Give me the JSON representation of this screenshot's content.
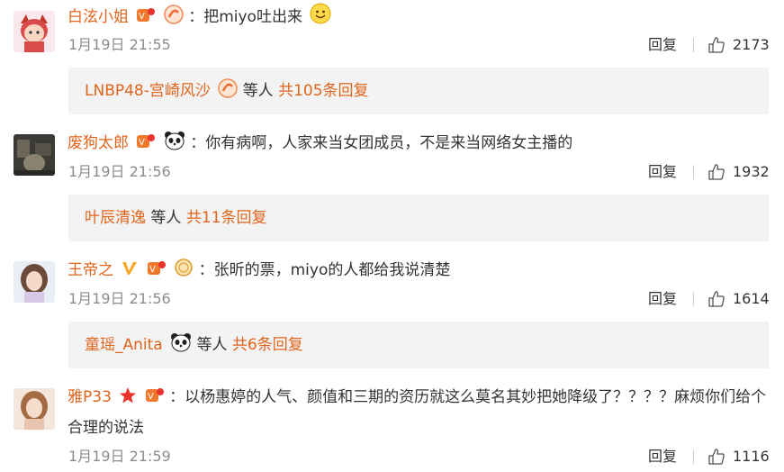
{
  "comments": [
    {
      "username": "白泫小姐",
      "text": "：把miyo吐出来",
      "timestamp": "1月19日 21:55",
      "reply_label": "回复",
      "likes": "2173",
      "reply_summary": {
        "names": "LNBP48-宫崎风沙",
        "mid": "等人",
        "count_text": "共105条回复"
      }
    },
    {
      "username": "废狗太郎",
      "text": "：你有病啊，人家来当女团成员，不是来当网络女主播的",
      "timestamp": "1月19日 21:56",
      "reply_label": "回复",
      "likes": "1932",
      "reply_summary": {
        "names": "叶辰清逸",
        "mid": "等人",
        "count_text": "共11条回复"
      }
    },
    {
      "username": "王帝之",
      "text": "：张昕的票，miyo的人都给我说清楚",
      "timestamp": "1月19日 21:56",
      "reply_label": "回复",
      "likes": "1614",
      "reply_summary": {
        "names": "童瑶_Anita",
        "mid": "等人",
        "count_text": "共6条回复"
      }
    },
    {
      "username": "雅P33",
      "text": "：以杨惠婷的人气、颜值和三期的资历就这么莫名其妙把她降级了？？？？麻烦你们给个合理的说法",
      "timestamp": "1月19日 21:59",
      "reply_label": "回复",
      "likes": "1116"
    }
  ],
  "colors": {
    "username": "#e0651c",
    "meta": "#8c8c8c",
    "reply_box_bg": "#f3f3f3"
  }
}
